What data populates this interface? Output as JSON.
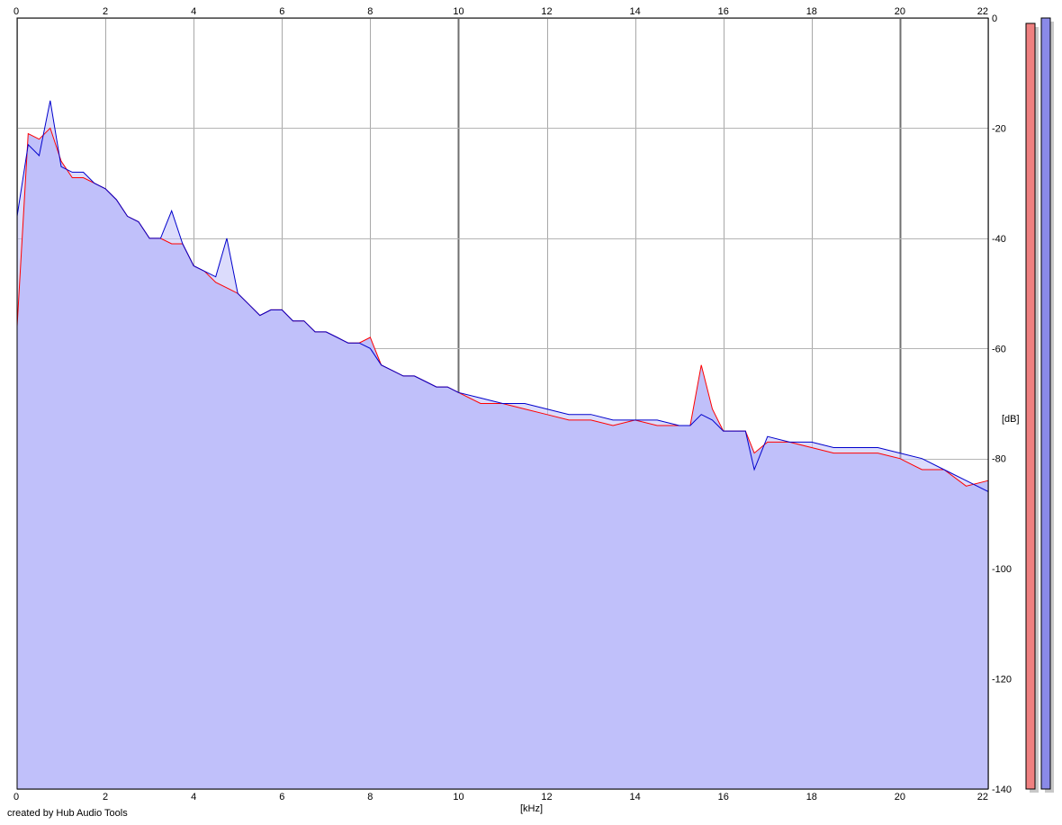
{
  "chart_data": {
    "type": "line",
    "xlabel": "[kHz]",
    "ylabel": "[dB]",
    "xlim": [
      0,
      22
    ],
    "ylim": [
      -140,
      0
    ],
    "x_ticks": [
      0,
      2,
      4,
      6,
      8,
      10,
      12,
      14,
      16,
      18,
      20,
      22
    ],
    "y_ticks": [
      0,
      -20,
      -40,
      -60,
      -80,
      -100,
      -120,
      -140
    ],
    "grid": true,
    "fill_under": true,
    "series": [
      {
        "color": "#ff0000",
        "x": [
          0,
          0.25,
          0.5,
          0.75,
          1,
          1.25,
          1.5,
          1.75,
          2,
          2.25,
          2.5,
          2.75,
          3,
          3.25,
          3.5,
          3.75,
          4,
          4.25,
          4.5,
          4.75,
          5,
          5.25,
          5.5,
          5.75,
          6,
          6.25,
          6.5,
          6.75,
          7,
          7.25,
          7.5,
          7.75,
          8,
          8.25,
          8.5,
          8.75,
          9,
          9.25,
          9.5,
          9.75,
          10,
          10.5,
          11,
          11.5,
          12,
          12.5,
          13,
          13.5,
          14,
          14.5,
          15,
          15.25,
          15.5,
          15.75,
          16,
          16.5,
          16.7,
          17,
          17.5,
          18,
          18.5,
          19,
          19.5,
          20,
          20.5,
          21,
          21.5,
          22
        ],
        "values": [
          -56,
          -21,
          -22,
          -20,
          -26,
          -29,
          -29,
          -30,
          -31,
          -33,
          -36,
          -37,
          -40,
          -40,
          -41,
          -41,
          -45,
          -46,
          -48,
          -49,
          -50,
          -52,
          -54,
          -53,
          -53,
          -55,
          -55,
          -57,
          -57,
          -58,
          -59,
          -59,
          -58,
          -63,
          -64,
          -65,
          -65,
          -66,
          -67,
          -67,
          -68,
          -70,
          -70,
          -71,
          -72,
          -73,
          -73,
          -74,
          -73,
          -74,
          -74,
          -74,
          -63,
          -71,
          -75,
          -75,
          -79,
          -77,
          -77,
          -78,
          -79,
          -79,
          -79,
          -80,
          -82,
          -82,
          -85,
          -84
        ]
      },
      {
        "color": "#0000cc",
        "x": [
          0,
          0.25,
          0.5,
          0.75,
          1,
          1.25,
          1.5,
          1.75,
          2,
          2.25,
          2.5,
          2.75,
          3,
          3.25,
          3.5,
          3.75,
          4,
          4.25,
          4.5,
          4.75,
          5,
          5.25,
          5.5,
          5.75,
          6,
          6.25,
          6.5,
          6.75,
          7,
          7.25,
          7.5,
          7.75,
          8,
          8.25,
          8.5,
          8.75,
          9,
          9.25,
          9.5,
          9.75,
          10,
          10.5,
          11,
          11.5,
          12,
          12.5,
          13,
          13.5,
          14,
          14.5,
          15,
          15.25,
          15.5,
          15.75,
          16,
          16.5,
          16.7,
          17,
          17.5,
          18,
          18.5,
          19,
          19.5,
          20,
          20.5,
          21,
          21.5,
          22
        ],
        "values": [
          -36,
          -23,
          -25,
          -15,
          -27,
          -28,
          -28,
          -30,
          -31,
          -33,
          -36,
          -37,
          -40,
          -40,
          -35,
          -41,
          -45,
          -46,
          -47,
          -40,
          -50,
          -52,
          -54,
          -53,
          -53,
          -55,
          -55,
          -57,
          -57,
          -58,
          -59,
          -59,
          -60,
          -63,
          -64,
          -65,
          -65,
          -66,
          -67,
          -67,
          -68,
          -69,
          -70,
          -70,
          -71,
          -72,
          -72,
          -73,
          -73,
          -73,
          -74,
          -74,
          -72,
          -73,
          -75,
          -75,
          -82,
          -76,
          -77,
          -77,
          -78,
          -78,
          -78,
          -79,
          -80,
          -82,
          -84,
          -86
        ]
      }
    ]
  },
  "credit": "created by Hub Audio Tools"
}
